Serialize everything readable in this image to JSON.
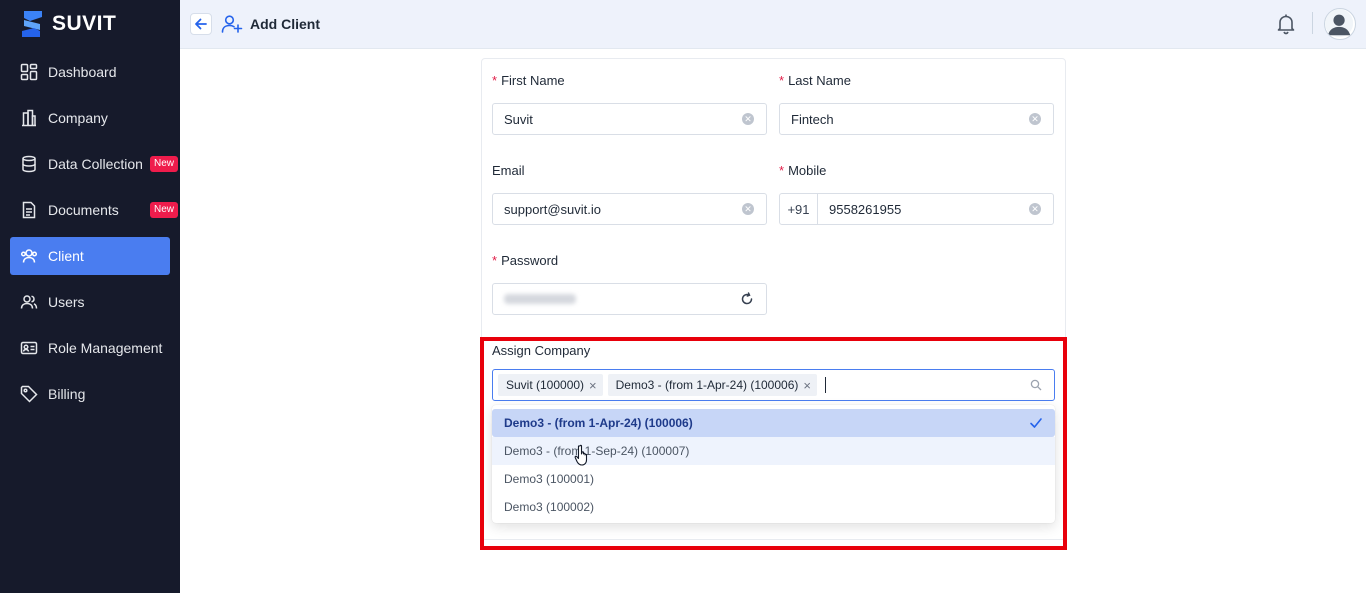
{
  "app": {
    "brand": "SUVIT"
  },
  "sidebar": {
    "items": [
      {
        "label": "Dashboard",
        "icon": "dashboard-icon"
      },
      {
        "label": "Company",
        "icon": "building-icon"
      },
      {
        "label": "Data Collection",
        "icon": "database-icon",
        "badge": "New"
      },
      {
        "label": "Documents",
        "icon": "document-icon",
        "badge": "New"
      },
      {
        "label": "Client",
        "icon": "users-icon",
        "active": true
      },
      {
        "label": "Users",
        "icon": "user-group-icon"
      },
      {
        "label": "Role Management",
        "icon": "id-card-icon"
      },
      {
        "label": "Billing",
        "icon": "tag-icon"
      }
    ]
  },
  "header": {
    "title": "Add Client"
  },
  "form": {
    "first_name": {
      "label": "First Name",
      "value": "Suvit"
    },
    "last_name": {
      "label": "Last Name",
      "value": "Fintech"
    },
    "email": {
      "label": "Email",
      "value": "support@suvit.io"
    },
    "mobile": {
      "label": "Mobile",
      "prefix": "+91",
      "value": "9558261955"
    },
    "password": {
      "label": "Password"
    },
    "assign_company": {
      "label": "Assign Company",
      "selected_tags": [
        "Suvit (100000)",
        "Demo3 - (from 1-Apr-24) (100006)"
      ],
      "options": [
        {
          "label": "Demo3 - (from 1-Apr-24) (100006)",
          "selected": true
        },
        {
          "label": "Demo3 - (from 1-Sep-24) (100007)",
          "hovered": true
        },
        {
          "label": "Demo3 (100001)"
        },
        {
          "label": "Demo3 (100002)"
        }
      ]
    }
  },
  "colors": {
    "sidebar_bg": "#161a2b",
    "accent": "#4a7df0",
    "badge": "#ef1c4c",
    "highlight_border": "#e8000b"
  }
}
